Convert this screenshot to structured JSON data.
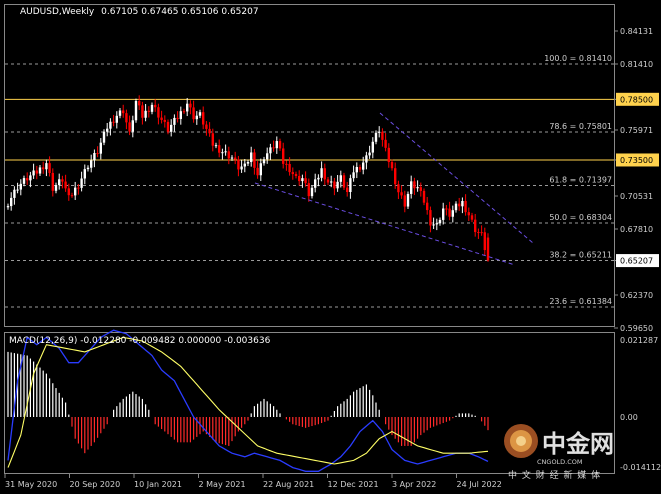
{
  "colors": {
    "background": "#000000",
    "candle_up": "#ffffff",
    "candle_down": "#ff0000",
    "fib_line": "#9a9a9a",
    "key_level": "#ffd24d",
    "trendline": "#6a4de0",
    "macd_histogram_up": "#ffffff",
    "macd_histogram_down": "#ff2a2a",
    "macd_line": "#2a3cff",
    "signal_line": "#ffff66"
  },
  "header": {
    "symbol": "AUDUSD,Weekly",
    "ohlc": "0.67105 0.67465 0.65106 0.65207"
  },
  "price_axis": {
    "ticks": [
      "0.84131",
      "0.81410",
      "0.78500",
      "0.75971",
      "0.73500",
      "0.70531",
      "0.67810",
      "0.65207",
      "0.62370",
      "0.59650"
    ],
    "highlighted": [
      "0.78500",
      "0.73500",
      "0.65207"
    ]
  },
  "fib_levels": [
    {
      "label": "100.0 = 0.81410",
      "price": 0.8141
    },
    {
      "label": "78.6 = 0.75801",
      "price": 0.75801
    },
    {
      "label": "61.8 = 0.71397",
      "price": 0.71397
    },
    {
      "label": "50.0 = 0.68304",
      "price": 0.68304
    },
    {
      "label": "38.2 = 0.65211",
      "price": 0.65211
    },
    {
      "label": "23.6 = 0.61384",
      "price": 0.61384
    }
  ],
  "key_levels": [
    0.785,
    0.735
  ],
  "macd": {
    "header": "MACD(12,26,9) -0.012280 -0.009482 0.000000 -0.003636",
    "axis_ticks": [
      "0.021287",
      "0.00",
      "-0.014112"
    ]
  },
  "time_axis": [
    "31 May 2020",
    "20 Sep 2020",
    "10 Jan 2021",
    "2 May 2021",
    "22 Aug 2021",
    "12 Dec 2021",
    "3 Apr 2022",
    "24 Jul 2022"
  ],
  "watermark": {
    "brand": "中金网",
    "tagline": "中 文 财 经 新 媒 体",
    "url": "CNGOLD.COM"
  },
  "chart_data": {
    "type": "candlestick",
    "symbol": "AUDUSD",
    "timeframe": "Weekly",
    "last_price": 0.65207,
    "ylim": [
      0.5965,
      0.8413
    ],
    "price_anchors": [
      [
        0,
        0.7
      ],
      [
        3,
        0.713
      ],
      [
        6,
        0.72
      ],
      [
        9,
        0.725
      ],
      [
        12,
        0.733
      ],
      [
        14,
        0.712
      ],
      [
        17,
        0.719
      ],
      [
        19,
        0.703
      ],
      [
        22,
        0.715
      ],
      [
        25,
        0.731
      ],
      [
        28,
        0.742
      ],
      [
        31,
        0.762
      ],
      [
        34,
        0.772
      ],
      [
        36,
        0.776
      ],
      [
        38,
        0.756
      ],
      [
        40,
        0.783
      ],
      [
        42,
        0.771
      ],
      [
        45,
        0.781
      ],
      [
        48,
        0.768
      ],
      [
        50,
        0.76
      ],
      [
        53,
        0.77
      ],
      [
        56,
        0.782
      ],
      [
        58,
        0.771
      ],
      [
        60,
        0.772
      ],
      [
        62,
        0.76
      ],
      [
        64,
        0.748
      ],
      [
        67,
        0.742
      ],
      [
        70,
        0.737
      ],
      [
        72,
        0.729
      ],
      [
        74,
        0.729
      ],
      [
        76,
        0.74
      ],
      [
        78,
        0.723
      ],
      [
        80,
        0.738
      ],
      [
        82,
        0.743
      ],
      [
        84,
        0.75
      ],
      [
        86,
        0.733
      ],
      [
        88,
        0.728
      ],
      [
        90,
        0.72
      ],
      [
        92,
        0.72
      ],
      [
        94,
        0.707
      ],
      [
        96,
        0.716
      ],
      [
        98,
        0.727
      ],
      [
        100,
        0.717
      ],
      [
        102,
        0.714
      ],
      [
        104,
        0.72
      ],
      [
        106,
        0.708
      ],
      [
        108,
        0.726
      ],
      [
        110,
        0.73
      ],
      [
        112,
        0.737
      ],
      [
        114,
        0.75
      ],
      [
        116,
        0.76
      ],
      [
        118,
        0.742
      ],
      [
        120,
        0.727
      ],
      [
        122,
        0.709
      ],
      [
        124,
        0.699
      ],
      [
        126,
        0.715
      ],
      [
        128,
        0.712
      ],
      [
        130,
        0.701
      ],
      [
        132,
        0.684
      ],
      [
        134,
        0.681
      ],
      [
        136,
        0.695
      ],
      [
        138,
        0.69
      ],
      [
        140,
        0.696
      ],
      [
        142,
        0.7
      ],
      [
        144,
        0.69
      ],
      [
        146,
        0.678
      ],
      [
        148,
        0.673
      ],
      [
        150,
        0.6521
      ]
    ],
    "macd_histogram_anchors": [
      [
        0,
        0.018
      ],
      [
        6,
        0.017
      ],
      [
        12,
        0.012
      ],
      [
        18,
        0.004
      ],
      [
        21,
        -0.006
      ],
      [
        24,
        -0.01
      ],
      [
        27,
        -0.007
      ],
      [
        31,
        -0.002
      ],
      [
        33,
        0.002
      ],
      [
        36,
        0.005
      ],
      [
        39,
        0.007
      ],
      [
        42,
        0.005
      ],
      [
        44,
        0.002
      ],
      [
        46,
        -0.002
      ],
      [
        49,
        -0.004
      ],
      [
        53,
        -0.007
      ],
      [
        57,
        -0.007
      ],
      [
        61,
        -0.004
      ],
      [
        65,
        -0.007
      ],
      [
        69,
        -0.008
      ],
      [
        72,
        -0.004
      ],
      [
        75,
        -0.001
      ],
      [
        77,
        0.003
      ],
      [
        80,
        0.005
      ],
      [
        83,
        0.003
      ],
      [
        86,
        0.0
      ],
      [
        89,
        -0.002
      ],
      [
        93,
        -0.003
      ],
      [
        97,
        -0.002
      ],
      [
        100,
        -0.001
      ],
      [
        103,
        0.003
      ],
      [
        106,
        0.005
      ],
      [
        108,
        0.007
      ],
      [
        110,
        0.008
      ],
      [
        112,
        0.009
      ],
      [
        114,
        0.006
      ],
      [
        116,
        0.002
      ],
      [
        118,
        -0.002
      ],
      [
        120,
        -0.005
      ],
      [
        123,
        -0.008
      ],
      [
        126,
        -0.008
      ],
      [
        129,
        -0.005
      ],
      [
        132,
        -0.003
      ],
      [
        135,
        -0.002
      ],
      [
        138,
        -0.001
      ],
      [
        141,
        0.001
      ],
      [
        144,
        0.001
      ],
      [
        147,
        0.0
      ],
      [
        150,
        -0.003636
      ]
    ],
    "macd_line_anchors": [
      [
        0,
        -0.012
      ],
      [
        3,
        0.01
      ],
      [
        6,
        0.022
      ],
      [
        9,
        0.02
      ],
      [
        12,
        0.022
      ],
      [
        16,
        0.019
      ],
      [
        19,
        0.015
      ],
      [
        22,
        0.015
      ],
      [
        25,
        0.018
      ],
      [
        29,
        0.022
      ],
      [
        33,
        0.024
      ],
      [
        37,
        0.023
      ],
      [
        41,
        0.02
      ],
      [
        45,
        0.017
      ],
      [
        48,
        0.013
      ],
      [
        52,
        0.01
      ],
      [
        55,
        0.005
      ],
      [
        58,
        0.0
      ],
      [
        62,
        -0.004
      ],
      [
        66,
        -0.008
      ],
      [
        70,
        -0.01
      ],
      [
        74,
        -0.011
      ],
      [
        77,
        -0.01
      ],
      [
        81,
        -0.011
      ],
      [
        85,
        -0.012
      ],
      [
        89,
        -0.014
      ],
      [
        93,
        -0.015
      ],
      [
        97,
        -0.015
      ],
      [
        101,
        -0.013
      ],
      [
        104,
        -0.011
      ],
      [
        107,
        -0.008
      ],
      [
        110,
        -0.004
      ],
      [
        114,
        -0.001
      ],
      [
        117,
        -0.004
      ],
      [
        120,
        -0.009
      ],
      [
        124,
        -0.012
      ],
      [
        128,
        -0.013
      ],
      [
        132,
        -0.012
      ],
      [
        136,
        -0.011
      ],
      [
        140,
        -0.01
      ],
      [
        144,
        -0.01
      ],
      [
        147,
        -0.011
      ],
      [
        150,
        -0.01228
      ]
    ],
    "signal_line_anchors": [
      [
        0,
        -0.014
      ],
      [
        4,
        -0.005
      ],
      [
        8,
        0.012
      ],
      [
        12,
        0.02
      ],
      [
        18,
        0.019
      ],
      [
        24,
        0.018
      ],
      [
        30,
        0.02
      ],
      [
        36,
        0.022
      ],
      [
        42,
        0.021
      ],
      [
        48,
        0.018
      ],
      [
        54,
        0.014
      ],
      [
        60,
        0.008
      ],
      [
        66,
        0.002
      ],
      [
        72,
        -0.003
      ],
      [
        78,
        -0.008
      ],
      [
        84,
        -0.01
      ],
      [
        90,
        -0.011
      ],
      [
        96,
        -0.012
      ],
      [
        102,
        -0.013
      ],
      [
        108,
        -0.012
      ],
      [
        112,
        -0.01
      ],
      [
        116,
        -0.006
      ],
      [
        120,
        -0.004
      ],
      [
        124,
        -0.006
      ],
      [
        128,
        -0.008
      ],
      [
        132,
        -0.009
      ],
      [
        136,
        -0.01
      ],
      [
        140,
        -0.01
      ],
      [
        144,
        -0.01
      ],
      [
        150,
        -0.009482
      ]
    ]
  }
}
